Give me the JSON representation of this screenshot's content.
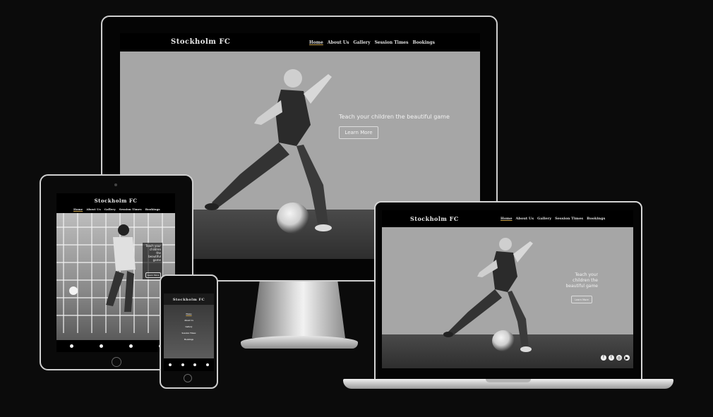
{
  "site": {
    "brand": "Stockholm FC",
    "nav": [
      "Home",
      "About Us",
      "Gallery",
      "Session Times",
      "Bookings"
    ],
    "hero_text": "Teach your children the beautiful game",
    "cta_label": "Learn More"
  },
  "tablet": {
    "hero_lines": [
      "Teach your",
      "children",
      "the",
      "beautiful",
      "game"
    ]
  },
  "laptop": {
    "hero_lines": [
      "Teach your",
      "children the",
      "beautiful game"
    ]
  },
  "icons": [
    "facebook-icon",
    "twitter-icon",
    "instagram-icon",
    "youtube-icon"
  ],
  "colors": {
    "background": "#0b0b0b",
    "hero_bg": "#a6a6a6",
    "nav_bg": "#000000",
    "active_underline": "#c8a14a"
  }
}
